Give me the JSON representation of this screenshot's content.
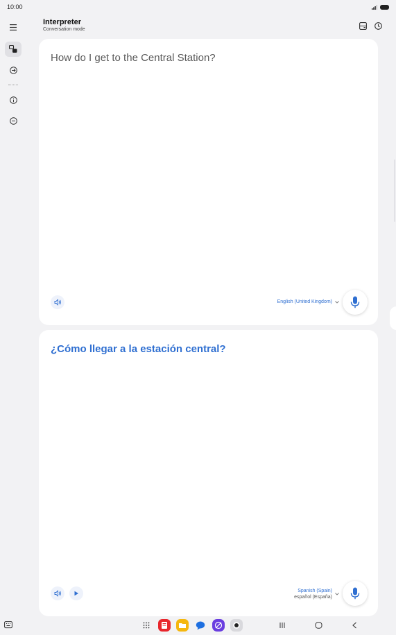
{
  "status_bar": {
    "time": "10:00"
  },
  "header": {
    "title": "Interpreter",
    "subtitle": "Conversation mode"
  },
  "source_panel": {
    "text": "How do I get to the Central Station?",
    "language": "English (United Kingdom)"
  },
  "target_panel": {
    "text": "¿Cómo llegar a la estación central?",
    "language": "Spanish (Spain)",
    "language_native": "español (España)"
  },
  "colors": {
    "accent": "#2f6fd1",
    "background": "#f2f2f4",
    "panel": "#ffffff"
  },
  "icons": {
    "sidebar": [
      "menu-icon",
      "conversation-icon",
      "translate-text-icon",
      "info-icon",
      "minus-circle-icon"
    ],
    "header": [
      "split-view-icon",
      "history-icon"
    ],
    "dock": [
      "apps-grid-icon",
      "red-app-icon",
      "yellow-app-icon",
      "messages-icon",
      "internet-icon",
      "camera-icon"
    ],
    "navigation": [
      "recents-icon",
      "home-icon",
      "back-icon"
    ]
  }
}
